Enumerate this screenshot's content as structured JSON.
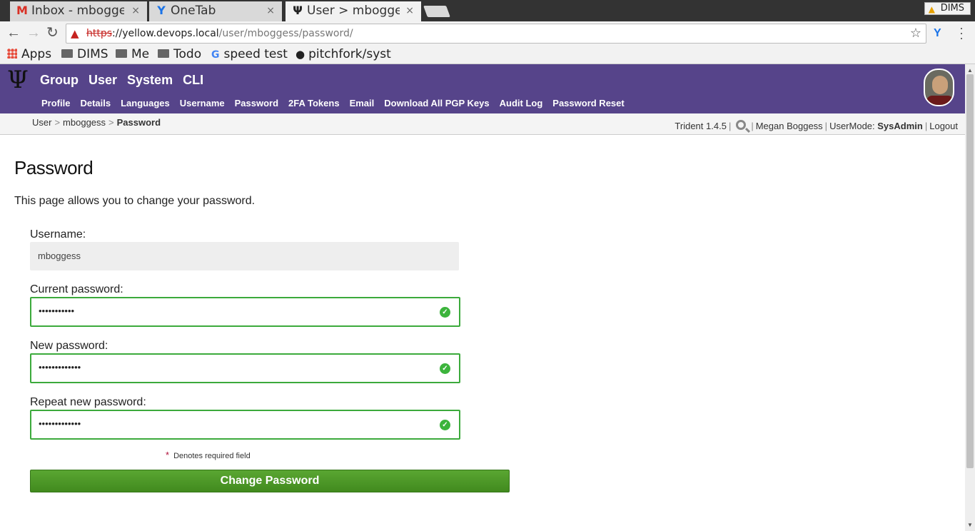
{
  "browser": {
    "tabs": [
      {
        "title": "Inbox - mbogge",
        "icon": "gmail-icon",
        "close": "×"
      },
      {
        "title": "OneTab",
        "icon": "onetab-icon",
        "close": "×"
      },
      {
        "title": "User > mbogges",
        "icon": "trident-icon",
        "close": "×"
      }
    ],
    "profile": "DIMS",
    "address": {
      "scheme": "https",
      "host": "://yellow.devops.local",
      "path": "/user/mboggess/password/"
    },
    "bookmarks": [
      {
        "label": "Apps",
        "icon": "apps-grid-icon"
      },
      {
        "label": "DIMS",
        "icon": "folder-icon"
      },
      {
        "label": "Me",
        "icon": "folder-icon"
      },
      {
        "label": "Todo",
        "icon": "folder-icon"
      },
      {
        "label": "speed test",
        "icon": "google-icon"
      },
      {
        "label": "pitchfork/syst",
        "icon": "github-icon"
      }
    ]
  },
  "app": {
    "logo": "Ψ",
    "main_nav": [
      "Group",
      "User",
      "System",
      "CLI"
    ],
    "sub_nav": [
      "Profile",
      "Details",
      "Languages",
      "Username",
      "Password",
      "2FA Tokens",
      "Email",
      "Download All PGP Keys",
      "Audit Log",
      "Password Reset"
    ],
    "breadcrumb": [
      "User",
      "mboggess",
      "Password"
    ],
    "breadcrumb_sep": ">",
    "status": {
      "version": "Trident 1.4.5",
      "user_name": "Megan Boggess",
      "mode_label": "UserMode:",
      "mode_value": "SysAdmin",
      "logout": "Logout"
    }
  },
  "page": {
    "title": "Password",
    "intro": "This page allows you to change your password.",
    "username_label": "Username:",
    "username_value": "mboggess",
    "current_label": "Current password:",
    "current_value": "•••••••••••",
    "new_label": "New password:",
    "new_value": "•••••••••••••",
    "repeat_label": "Repeat new password:",
    "repeat_value": "•••••••••••••",
    "required_marker": "*",
    "required_note": "Denotes required field",
    "submit_label": "Change Password",
    "valid_color": "#3cb43c",
    "header_color": "#56448a"
  }
}
